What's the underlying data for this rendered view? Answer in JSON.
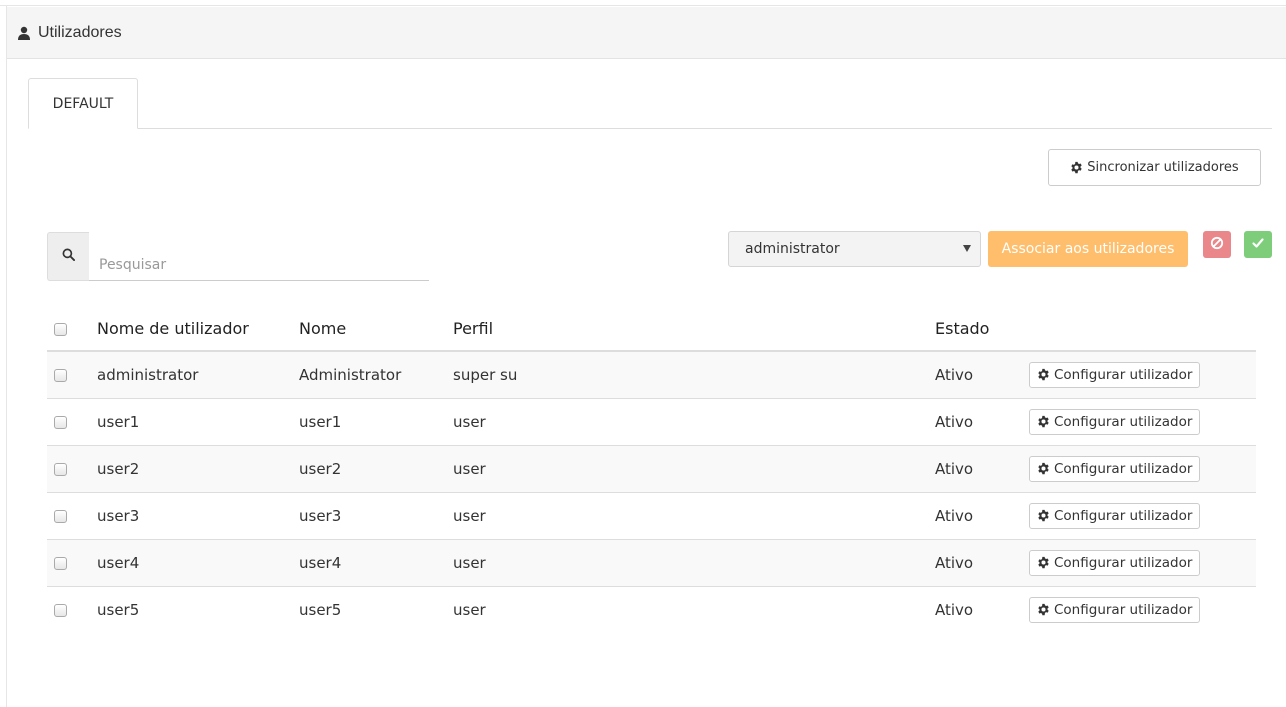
{
  "header": {
    "title": "Utilizadores",
    "icon": "user-icon"
  },
  "tabs": [
    {
      "label": "DEFAULT"
    }
  ],
  "toolbar": {
    "sync_label": "Sincronizar utilizadores"
  },
  "search": {
    "placeholder": "Pesquisar",
    "value": ""
  },
  "bulk": {
    "profile_selected": "administrator",
    "associate_label": "Associar aos utilizadores"
  },
  "table": {
    "columns": [
      "Nome de utilizador",
      "Nome",
      "Perfil",
      "Estado"
    ],
    "config_label": "Configurar utilizador",
    "rows": [
      {
        "username": "administrator",
        "name": "Administrator",
        "profile": "super su",
        "status": "Ativo"
      },
      {
        "username": "user1",
        "name": "user1",
        "profile": "user",
        "status": "Ativo"
      },
      {
        "username": "user2",
        "name": "user2",
        "profile": "user",
        "status": "Ativo"
      },
      {
        "username": "user3",
        "name": "user3",
        "profile": "user",
        "status": "Ativo"
      },
      {
        "username": "user4",
        "name": "user4",
        "profile": "user",
        "status": "Ativo"
      },
      {
        "username": "user5",
        "name": "user5",
        "profile": "user",
        "status": "Ativo"
      }
    ]
  },
  "colors": {
    "accent_orange": "#ffb75b",
    "danger": "#e9878a",
    "success": "#7dcd7b"
  }
}
